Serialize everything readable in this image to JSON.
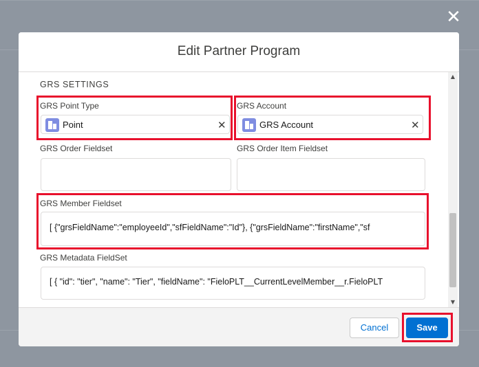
{
  "modal": {
    "title": "Edit Partner Program",
    "close_label": "✕"
  },
  "section": {
    "title": "GRS SETTINGS"
  },
  "fields": {
    "point_type": {
      "label": "GRS Point Type",
      "value": "Point",
      "clear": "✕"
    },
    "account": {
      "label": "GRS Account",
      "value": "GRS Account",
      "clear": "✕"
    },
    "order_fieldset": {
      "label": "GRS Order Fieldset",
      "value": ""
    },
    "order_item_fieldset": {
      "label": "GRS Order Item Fieldset",
      "value": ""
    },
    "member_fieldset": {
      "label": "GRS Member Fieldset",
      "value": "[   {\"grsFieldName\":\"employeeId\",\"sfFieldName\":\"Id\"},   {\"grsFieldName\":\"firstName\",\"sf"
    },
    "metadata_fieldset": {
      "label": "GRS Metadata FieldSet",
      "value": "[ { \"id\": \"tier\", \"name\": \"Tier\", \"fieldName\": \"FieloPLT__CurrentLevelMember__r.FieloPLT"
    }
  },
  "footer": {
    "cancel_label": "Cancel",
    "save_label": "Save"
  },
  "colors": {
    "highlight": "#e8102c",
    "brand": "#0070d2",
    "lookup_icon": "#7f8de1"
  },
  "icons": {
    "close": "close-icon",
    "lookup": "record-icon",
    "clear": "clear-icon",
    "scroll_up": "chevron-up-icon",
    "scroll_down": "chevron-down-icon"
  }
}
